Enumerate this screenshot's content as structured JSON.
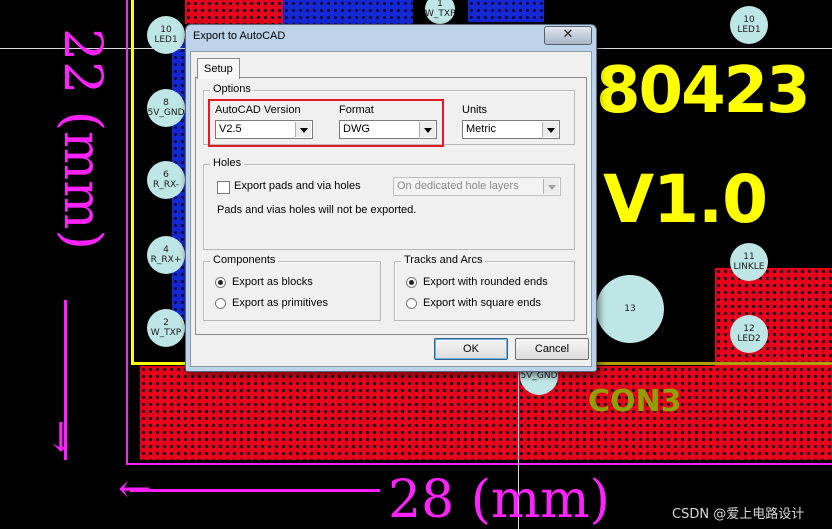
{
  "pcb": {
    "pads": [
      {
        "num": "10",
        "name": "LED1"
      },
      {
        "num": "8",
        "name": "5V_GND"
      },
      {
        "num": "6",
        "name": "R_RX-"
      },
      {
        "num": "4",
        "name": "R_RX+"
      },
      {
        "num": "2",
        "name": "W_TXP"
      },
      {
        "num": "1",
        "name": "W_TXP"
      },
      {
        "num": "10",
        "name": "LED1"
      },
      {
        "num": "11",
        "name": "LINKLE"
      },
      {
        "num": "12",
        "name": "LED2"
      },
      {
        "num": "13",
        "name": ""
      },
      {
        "num": "",
        "name": "5V_GND"
      }
    ],
    "silk_number": "80423",
    "silk_version": "V1.0",
    "silk_con": "CON3",
    "dim_vertical": "22 (mm)",
    "dim_horizontal": "28 (mm)"
  },
  "dialog": {
    "title": "Export to AutoCAD",
    "close_glyph": "✕",
    "tab": "Setup",
    "options": {
      "group_label": "Options",
      "version_label": "AutoCAD Version",
      "version_value": "V2.5",
      "format_label": "Format",
      "format_value": "DWG",
      "units_label": "Units",
      "units_value": "Metric"
    },
    "holes": {
      "group_label": "Holes",
      "export_label": "Export pads and via holes",
      "layer_value": "On dedicated hole layers",
      "note": "Pads and vias holes will not be exported."
    },
    "components": {
      "group_label": "Components",
      "opt_blocks": "Export as blocks",
      "opt_primitives": "Export as primitives"
    },
    "tracks": {
      "group_label": "Tracks and Arcs",
      "opt_rounded": "Export with rounded ends",
      "opt_square": "Export with square ends"
    },
    "ok_label": "OK",
    "cancel_label": "Cancel"
  },
  "watermark": "CSDN @爱上电路设计",
  "colors": {
    "copper": "#e8001c",
    "silk": "#ffff00",
    "dimension": "#ff22ff",
    "highlight": "#e21a24",
    "dialog_frame": "#bcd3ea"
  }
}
